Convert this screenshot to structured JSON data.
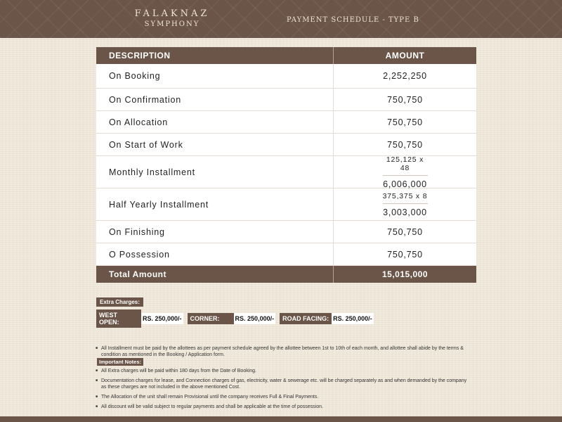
{
  "header": {
    "brand": "FALAKNAZ",
    "brand_sub": "SYMPHONY",
    "title": "PAYMENT SCHEDULE - TYPE B"
  },
  "table": {
    "col_desc": "DESCRIPTION",
    "col_amount": "AMOUNT",
    "rows": [
      {
        "desc": "On Booking",
        "amount": "2,252,250"
      },
      {
        "desc": "On Confirmation",
        "amount": "750,750"
      },
      {
        "desc": "On Allocation",
        "amount": "750,750"
      },
      {
        "desc": "On Start of Work",
        "amount": "750,750"
      },
      {
        "desc": "Monthly Installment",
        "calc": "125,125 x 48",
        "amount": "6,006,000"
      },
      {
        "desc": "Half Yearly Installment",
        "calc": "375,375 x 8",
        "amount": "3,003,000"
      },
      {
        "desc": "On Finishing",
        "amount": "750,750"
      },
      {
        "desc": "O Possession",
        "amount": "750,750"
      }
    ],
    "total_label": "Total Amount",
    "total_amount": "15,015,000"
  },
  "extra": {
    "label": "Extra Charges:",
    "items": [
      {
        "key": "WEST OPEN:",
        "value": "RS. 250,000/-"
      },
      {
        "key": "CORNER:",
        "value": "RS. 250,000/-"
      },
      {
        "key": "ROAD FACING:",
        "value": "RS. 250,000/-"
      }
    ]
  },
  "notes": {
    "label": "Important Notes:",
    "items": [
      "All Installment must be paid by the allottees as per payment schedule agreed by the allottee between 1st to 10th of each month, and allottee shall abide by the terms & condition as mentioned in the Booking / Application form.",
      "All Extra charges will be paid within 180 days from the Date of Booking.",
      "Documentation charges for lease, and Connection charges of gas, electricity, water & sewerage etc. will be charged separately as and when demanded by the company as these charges are not included in the above mentioned Cost.",
      "The Allocation of the unit shall remain Provisional until the company receives Full & Final Payments.",
      "All discount will be valid subject to regular payments and shall be applicable at the time of possession."
    ]
  }
}
